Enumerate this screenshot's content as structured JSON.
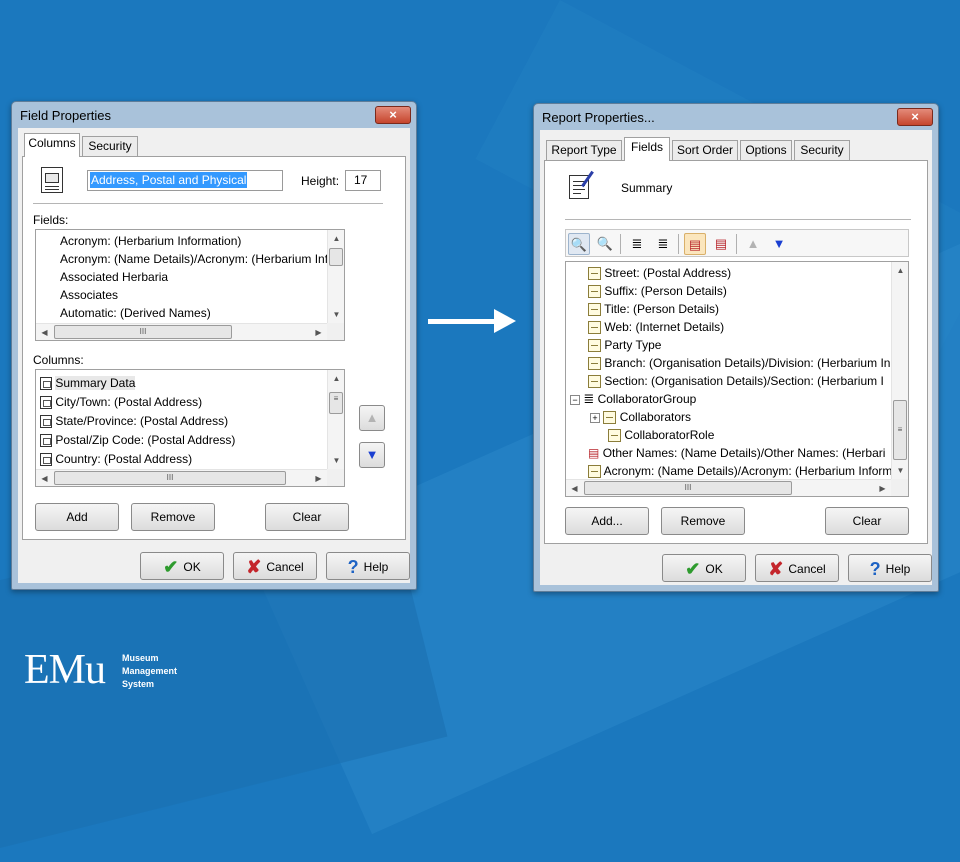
{
  "brand": {
    "logo_text": "EMu",
    "subtitle_lines": [
      "Museum",
      "Management",
      "System"
    ]
  },
  "field_properties": {
    "title": "Field Properties",
    "close_label": "×",
    "tabs": [
      {
        "label": "Columns",
        "active": true
      },
      {
        "label": "Security",
        "active": false
      }
    ],
    "name_value": "Address, Postal and Physical",
    "height_label": "Height:",
    "height_value": "17",
    "fields_label": "Fields:",
    "fields_items": [
      "Acronym: (Herbarium Information)",
      "Acronym: (Name Details)/Acronym: (Herbarium Info",
      "Associated Herbaria",
      "Associates",
      "Automatic: (Derived Names)"
    ],
    "columns_label": "Columns:",
    "columns_items": [
      "Summary Data",
      "City/Town: (Postal Address)",
      "State/Province: (Postal Address)",
      "Postal/Zip Code: (Postal Address)",
      "Country: (Postal Address)"
    ],
    "buttons": {
      "add": "Add",
      "remove": "Remove",
      "clear": "Clear"
    },
    "footer": {
      "ok": "OK",
      "cancel": "Cancel",
      "help": "Help"
    }
  },
  "report_properties": {
    "title": "Report Properties...",
    "close_label": "×",
    "tabs": [
      {
        "label": "Report Type",
        "active": false
      },
      {
        "label": "Fields",
        "active": true
      },
      {
        "label": "Sort Order",
        "active": false
      },
      {
        "label": "Options",
        "active": false
      },
      {
        "label": "Security",
        "active": false
      }
    ],
    "summary_label": "Summary",
    "tree_items": [
      {
        "label": "Street: (Postal Address)",
        "icon": "field-icon",
        "level": 1
      },
      {
        "label": "Suffix: (Person Details)",
        "icon": "field-icon",
        "level": 1
      },
      {
        "label": "Title: (Person Details)",
        "icon": "field-icon",
        "level": 1
      },
      {
        "label": "Web: (Internet Details)",
        "icon": "field-icon",
        "level": 1
      },
      {
        "label": "Party Type",
        "icon": "field-icon",
        "level": 1
      },
      {
        "label": "Branch: (Organisation Details)/Division: (Herbarium In",
        "icon": "field-icon",
        "level": 1
      },
      {
        "label": "Section: (Organisation Details)/Section: (Herbarium I",
        "icon": "field-icon",
        "level": 1
      },
      {
        "label": "CollaboratorGroup",
        "icon": "group-icon",
        "level": 1,
        "expander": "−"
      },
      {
        "label": "Collaborators",
        "icon": "field-icon",
        "level": 2,
        "expander": "+"
      },
      {
        "label": "CollaboratorRole",
        "icon": "field-icon",
        "level": 2
      },
      {
        "label": "Other Names: (Name Details)/Other Names: (Herbari",
        "icon": "attached-field-icon",
        "level": 1
      },
      {
        "label": "Acronym: (Name Details)/Acronym: (Herbarium Inform",
        "icon": "field-icon",
        "level": 1
      }
    ],
    "buttons": {
      "add": "Add...",
      "remove": "Remove",
      "clear": "Clear"
    },
    "footer": {
      "ok": "OK",
      "cancel": "Cancel",
      "help": "Help"
    }
  },
  "colors": {
    "background": "#1b78be",
    "ok_check": "#2e9b2e",
    "cancel_x": "#c4262c",
    "help_q": "#1e63c4",
    "move_down_arrow": "#1a3fd1"
  }
}
